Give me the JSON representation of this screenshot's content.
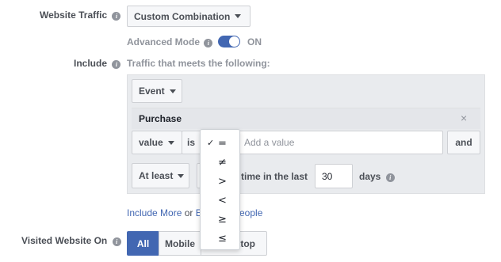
{
  "website_traffic": {
    "label": "Website Traffic",
    "selected": "Custom Combination"
  },
  "advanced_mode": {
    "label": "Advanced Mode",
    "state": "ON"
  },
  "include": {
    "label": "Include",
    "description": "Traffic that meets the following:",
    "event_select": "Event",
    "event_name": "Purchase",
    "remove_symbol": "×",
    "param_select": "value",
    "operator_select_partial": "is",
    "value_placeholder": "Add a value",
    "and_button": "and",
    "frequency_select": "At least",
    "time_text": "time in the last",
    "days_value": "30",
    "days_label": "days"
  },
  "operator_menu": {
    "checked_symbol": "✓",
    "options": [
      "=",
      "≠",
      ">",
      "<",
      "≥",
      "≤"
    ]
  },
  "links": {
    "include_more": "Include More",
    "or": "or",
    "exclude_partial_left": "E",
    "exclude_partial_right": "eople"
  },
  "visited_on": {
    "label": "Visited Website On",
    "options": [
      "All",
      "Mobile",
      "ktop"
    ],
    "selected": "All"
  },
  "colors": {
    "accent": "#4267b2",
    "panel": "#e9ebee",
    "text": "#4b4f56",
    "muted": "#90949c"
  }
}
